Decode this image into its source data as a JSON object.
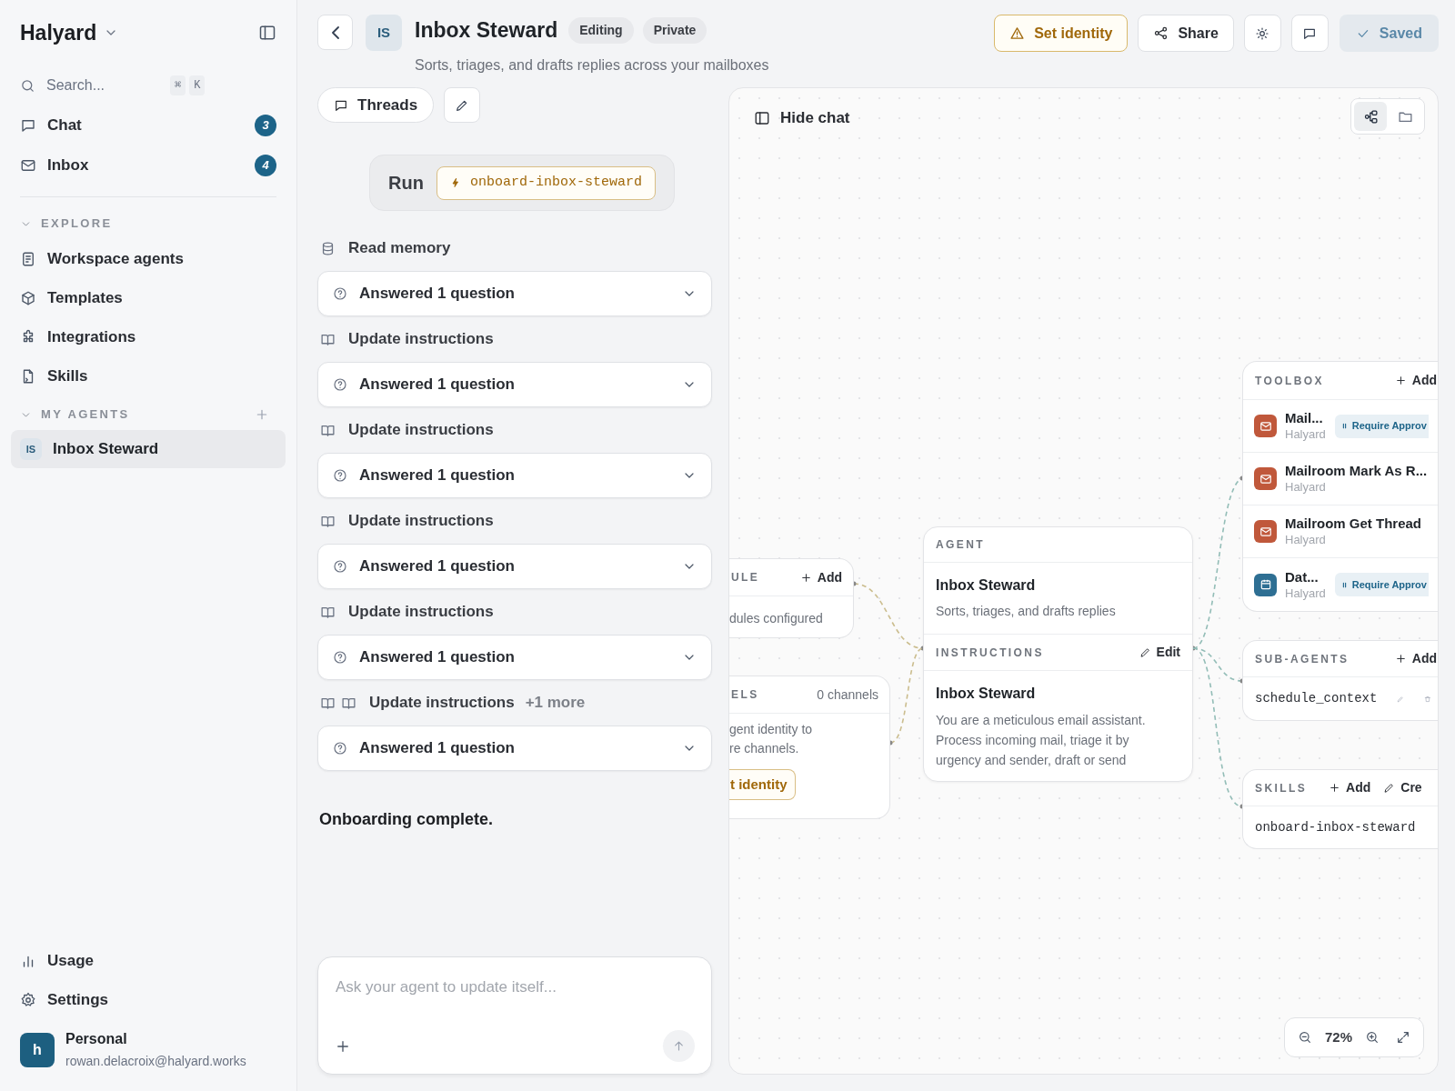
{
  "sidebar": {
    "workspace": "Halyard",
    "search": {
      "placeholder": "Search...",
      "keys": [
        "⌘",
        "K"
      ]
    },
    "nav": [
      {
        "label": "Chat",
        "badge": "3"
      },
      {
        "label": "Inbox",
        "badge": "4"
      }
    ],
    "sections": [
      {
        "title": "EXPLORE",
        "expanded": true,
        "items": [
          {
            "label": "Workspace agents"
          },
          {
            "label": "Templates"
          },
          {
            "label": "Integrations"
          },
          {
            "label": "Skills"
          }
        ]
      },
      {
        "title": "MY AGENTS",
        "expanded": true,
        "items": [
          {
            "label": "Inbox Steward",
            "initials": "IS",
            "selected": true
          }
        ]
      }
    ],
    "footer": [
      {
        "label": "Usage"
      },
      {
        "label": "Settings"
      }
    ],
    "account": {
      "initial": "h",
      "name": "Personal",
      "email": "rowan.delacroix@halyard.works"
    }
  },
  "header": {
    "initials": "IS",
    "title": "Inbox Steward",
    "badges": [
      "Editing",
      "Private"
    ],
    "subtitle": "Sorts, triages, and drafts replies across your mailboxes",
    "actions": [
      {
        "kind": "warning",
        "label": "Set identity"
      },
      {
        "kind": "plain",
        "label": "Share"
      },
      {
        "kind": "icon"
      },
      {
        "kind": "icon"
      },
      {
        "kind": "saved",
        "label": "Saved"
      }
    ]
  },
  "chat": {
    "threads_label": "Threads",
    "run": {
      "label": "Run",
      "skill": "onboard-inbox-steward"
    },
    "activity": [
      {
        "kind": "memory",
        "label": "Read memory"
      },
      {
        "kind": "question",
        "label": "Answered 1 question"
      },
      {
        "kind": "instructions",
        "label": "Update instructions"
      },
      {
        "kind": "question",
        "label": "Answered 1 question"
      },
      {
        "kind": "instructions",
        "label": "Update instructions"
      },
      {
        "kind": "question",
        "label": "Answered 1 question"
      },
      {
        "kind": "instructions",
        "label": "Update instructions"
      },
      {
        "kind": "question",
        "label": "Answered 1 question"
      },
      {
        "kind": "instructions",
        "label": "Update instructions"
      },
      {
        "kind": "question",
        "label": "Answered 1 question"
      },
      {
        "kind": "instructions",
        "label": "Update instructions",
        "extra": "+1 more"
      },
      {
        "kind": "question",
        "label": "Answered 1 question"
      },
      {
        "kind": "message",
        "label": "Onboarding complete."
      }
    ],
    "input": {
      "placeholder": "Ask your agent to update itself..."
    }
  },
  "canvas": {
    "hide_label": "Hide chat",
    "view_toggle": [
      {
        "selected": true
      },
      {
        "selected": false
      }
    ],
    "schedule": {
      "title": "ULE",
      "action": "Add",
      "body": "dules configured"
    },
    "channels": {
      "title": "ELS",
      "count": "0 channels",
      "body": [
        "gent identity to",
        "re channels."
      ],
      "button": "t identity"
    },
    "agent": {
      "title": "AGENT",
      "name": "Inbox Steward",
      "description": "Sorts, triages, and drafts replies",
      "instructions_title": "INSTRUCTIONS",
      "edit": "Edit",
      "instructions_name": "Inbox Steward",
      "instructions": "You are a meticulous email assistant. Process incoming mail, triage it by urgency and sender, draft or send"
    },
    "toolbox": {
      "title": "TOOLBOX",
      "action": "Add",
      "tools": [
        {
          "name": "Mail...",
          "vendor": "Halyard",
          "color": "#c0583b",
          "approval": "Require Approv"
        },
        {
          "name": "Mailroom Mark As R...",
          "vendor": "Halyard",
          "color": "#c0583b"
        },
        {
          "name": "Mailroom Get Thread",
          "vendor": "Halyard",
          "color": "#c0583b"
        },
        {
          "name": "Dat...",
          "vendor": "Halyard",
          "color": "#2e6f93",
          "approval": "Require Approv"
        }
      ]
    },
    "sub_agents": {
      "title": "SUB-AGENTS",
      "action": "Add",
      "items": [
        "schedule_context"
      ]
    },
    "skills": {
      "title": "SKILLS",
      "actions": [
        "Add",
        "Cre"
      ],
      "items": [
        "onboard-inbox-steward"
      ]
    },
    "zoom": "72%"
  }
}
